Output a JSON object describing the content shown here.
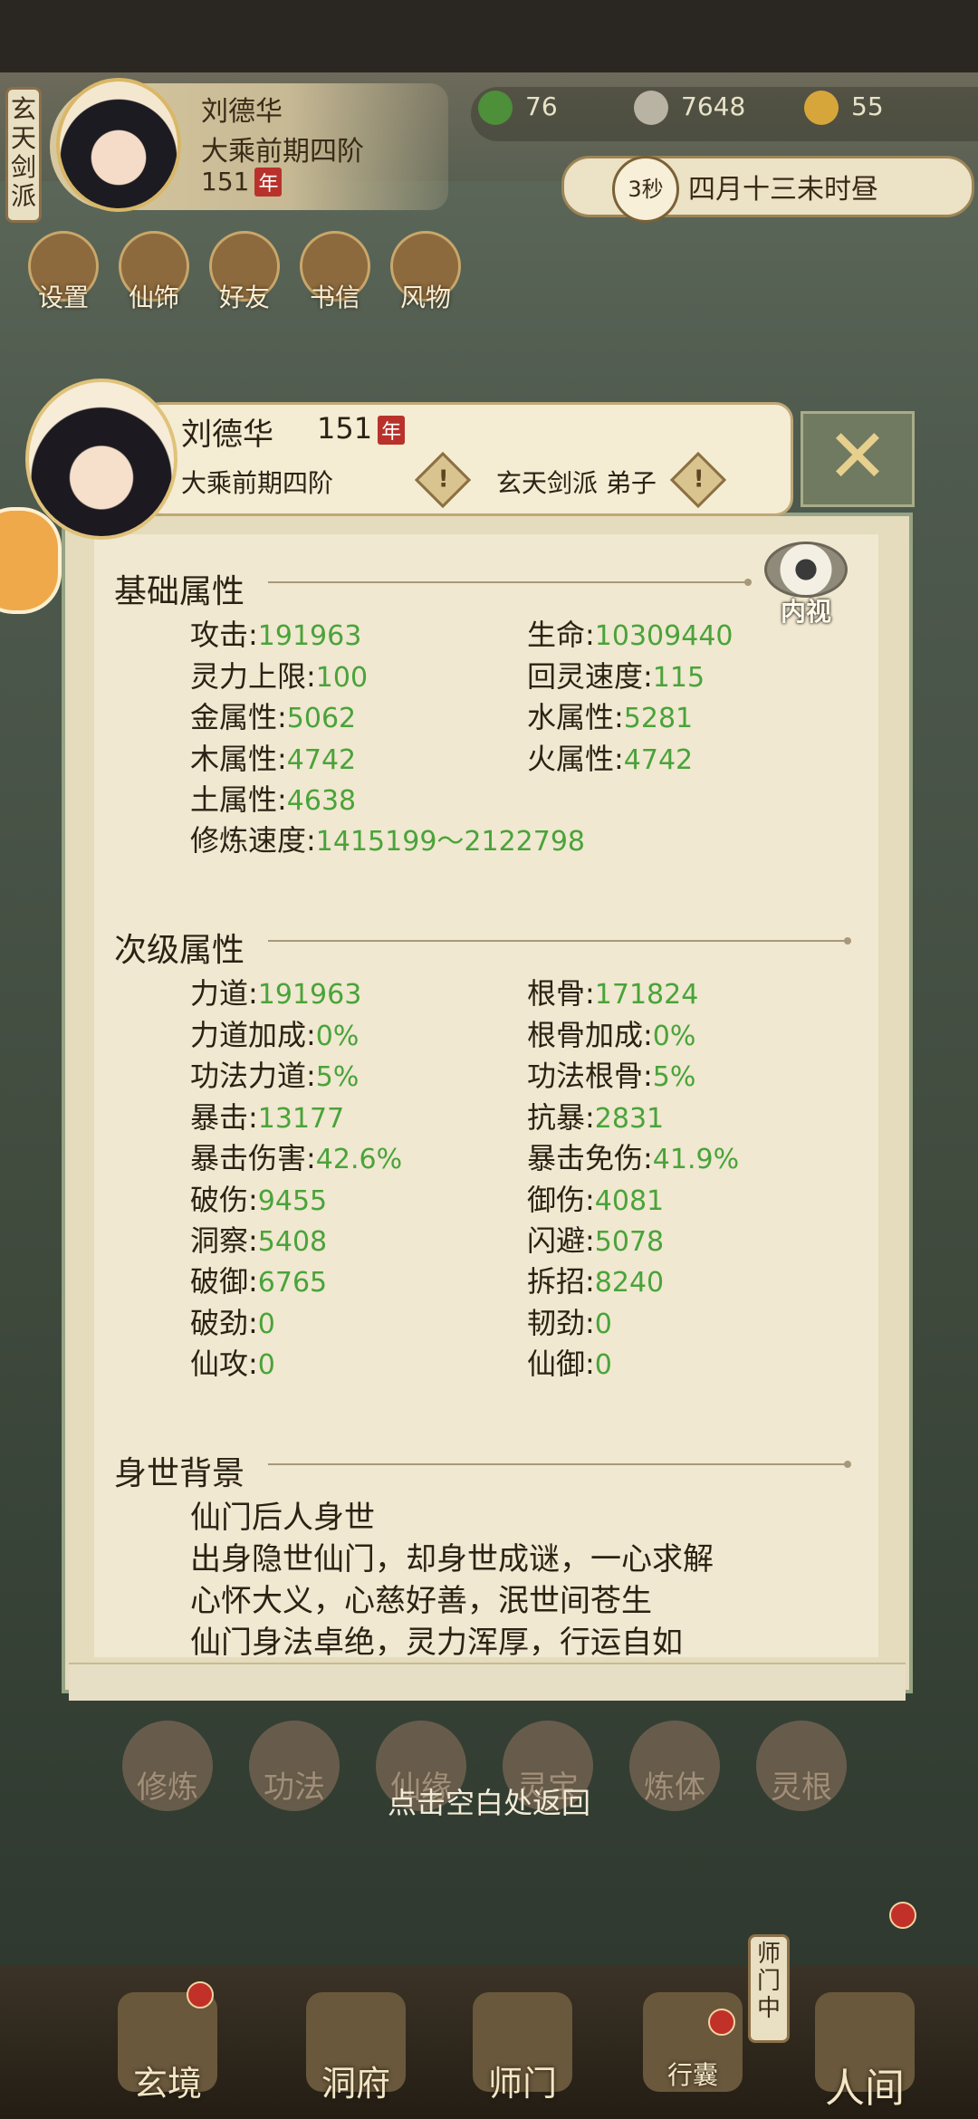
{
  "top": {
    "sect_tag": [
      "玄",
      "天",
      "剑",
      "派"
    ],
    "player_name": "刘德华",
    "realm": "大乘前期四阶",
    "age": "151",
    "age_unit": "年",
    "resources": [
      {
        "icon": "jade-leaf-icon",
        "value": "76",
        "color": "#4e8f3a"
      },
      {
        "icon": "spirit-stone-icon",
        "value": "7648",
        "color": "#b8b3a2"
      },
      {
        "icon": "strength-icon",
        "value": "55",
        "color": "#d7a63a"
      }
    ],
    "timer": "3秒",
    "time_text": "四月十三未时昼",
    "menu": [
      "设置",
      "仙饰",
      "好友",
      "书信",
      "风物"
    ]
  },
  "modal": {
    "name": "刘德华",
    "age": "151",
    "age_unit": "年",
    "realm": "大乘前期四阶",
    "sect": "玄天剑派 弟子",
    "warn_symbol": "!",
    "close_symbol": "✕",
    "inspect_label": "内视",
    "sections": {
      "basic": {
        "title": "基础属性",
        "attrs": [
          {
            "label": "攻击:",
            "value": "191963"
          },
          {
            "label": "生命:",
            "value": "10309440"
          },
          {
            "label": "灵力上限:",
            "value": "100"
          },
          {
            "label": "回灵速度:",
            "value": "115"
          },
          {
            "label": "金属性:",
            "value": "5062"
          },
          {
            "label": "水属性:",
            "value": "5281"
          },
          {
            "label": "木属性:",
            "value": "4742"
          },
          {
            "label": "火属性:",
            "value": "4742"
          },
          {
            "label": "土属性:",
            "value": "4638"
          },
          {
            "label": "修炼速度:",
            "value": "1415199～2122798"
          }
        ]
      },
      "secondary": {
        "title": "次级属性",
        "attrs": [
          {
            "label": "力道:",
            "value": "191963"
          },
          {
            "label": "根骨:",
            "value": "171824"
          },
          {
            "label": "力道加成:",
            "value": "0%"
          },
          {
            "label": "根骨加成:",
            "value": "0%"
          },
          {
            "label": "功法力道:",
            "value": "5%"
          },
          {
            "label": "功法根骨:",
            "value": "5%"
          },
          {
            "label": "暴击:",
            "value": "13177"
          },
          {
            "label": "抗暴:",
            "value": "2831"
          },
          {
            "label": "暴击伤害:",
            "value": "42.6%"
          },
          {
            "label": "暴击免伤:",
            "value": "41.9%"
          },
          {
            "label": "破伤:",
            "value": "9455"
          },
          {
            "label": "御伤:",
            "value": "4081"
          },
          {
            "label": "洞察:",
            "value": "5408"
          },
          {
            "label": "闪避:",
            "value": "5078"
          },
          {
            "label": "破御:",
            "value": "6765"
          },
          {
            "label": "拆招:",
            "value": "8240"
          },
          {
            "label": "破劲:",
            "value": "0"
          },
          {
            "label": "韧劲:",
            "value": "0"
          },
          {
            "label": "仙攻:",
            "value": "0"
          },
          {
            "label": "仙御:",
            "value": "0"
          }
        ]
      },
      "background": {
        "title": "身世背景",
        "lines": [
          "仙门后人身世",
          "出身隐世仙门，却身世成谜，一心求解",
          "心怀大义，心慈好善，泯世间苍生",
          "仙门身法卓绝，灵力浑厚，行运自如"
        ]
      }
    }
  },
  "features": [
    "修炼",
    "功法",
    "仙缘",
    "灵宝",
    "炼体",
    "灵根"
  ],
  "tap_return": "点击空白处返回",
  "bottom_nav": [
    "玄境",
    "洞府",
    "师门",
    "行囊",
    "人间"
  ],
  "shimen_tag": [
    "师",
    "门",
    "中"
  ]
}
